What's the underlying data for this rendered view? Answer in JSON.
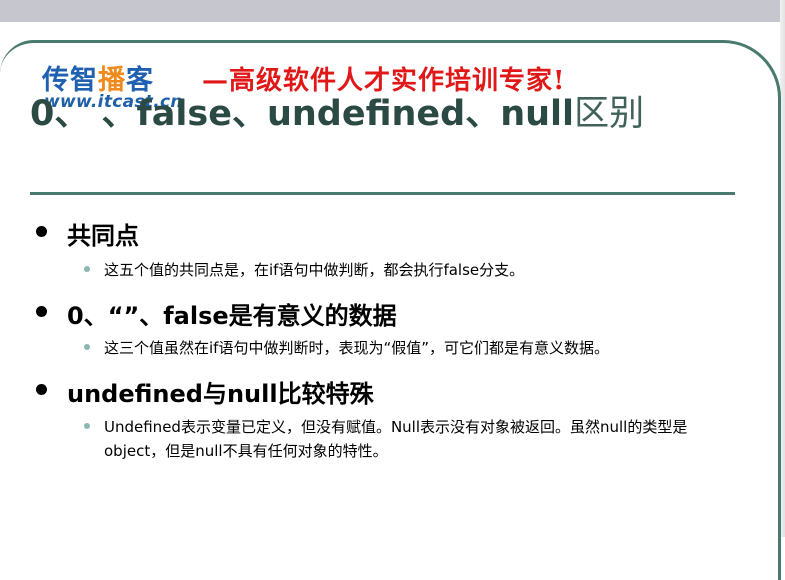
{
  "header": {
    "logo_part1": "传智",
    "logo_highlight": "播",
    "logo_part2": "客",
    "logo_url": "www.itcast.cn",
    "slogan": "—高级软件人才实作培训专家!"
  },
  "slide": {
    "title_main": "0、 、false、undefined、null",
    "title_tail": "区别"
  },
  "bullets": [
    {
      "label": "共同点",
      "subs": [
        "这五个值的共同点是，在if语句中做判断，都会执行false分支。"
      ]
    },
    {
      "label": "0、“”、false是有意义的数据",
      "subs": [
        "这三个值虽然在if语句中做判断时，表现为“假值”，可它们都是有意义数据。"
      ]
    },
    {
      "label": "undefined与null比较特殊",
      "subs": [
        "Undefined表示变量已定义，但没有赋值。Null表示没有对象被返回。虽然null的类型是object，但是null不具有任何对象的特性。"
      ]
    }
  ],
  "colors": {
    "frame": "#4a7a6e",
    "title": "#2c4a44",
    "logo_blue": "#2060b0",
    "logo_orange": "#f08a1c",
    "slogan_red": "#e01818",
    "sub_bullet": "#8ab8b0"
  }
}
